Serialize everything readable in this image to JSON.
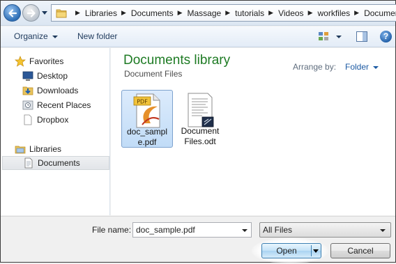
{
  "address_bar": {
    "crumbs": [
      "Libraries",
      "Documents",
      "Massage",
      "tutorials",
      "Videos",
      "workfiles",
      "Documents"
    ]
  },
  "toolbar": {
    "organize_label": "Organize",
    "new_folder_label": "New folder",
    "help_label": "?"
  },
  "nav": {
    "favorites_label": "Favorites",
    "desktop_label": "Desktop",
    "downloads_label": "Downloads",
    "recent_places_label": "Recent Places",
    "dropbox_label": "Dropbox",
    "libraries_label": "Libraries",
    "documents_label": "Documents"
  },
  "content": {
    "title": "Documents library",
    "subtitle": "Document Files",
    "arrange_by_label": "Arrange by:",
    "arrange_by_value": "Folder",
    "files": [
      {
        "name_line1": "doc_sampl",
        "name_line2": "e.pdf",
        "badge": "PDF"
      },
      {
        "name_line1": "Document",
        "name_line2": "Files.odt"
      }
    ]
  },
  "bottom": {
    "file_name_label": "File name:",
    "file_name_value": "doc_sample.pdf",
    "file_type_value": "All Files",
    "open_label": "Open",
    "cancel_label": "Cancel"
  },
  "colors": {
    "library_title": "#1e7b24",
    "link_blue": "#1c5aa3",
    "selection_bg": "#c1dcf7"
  }
}
